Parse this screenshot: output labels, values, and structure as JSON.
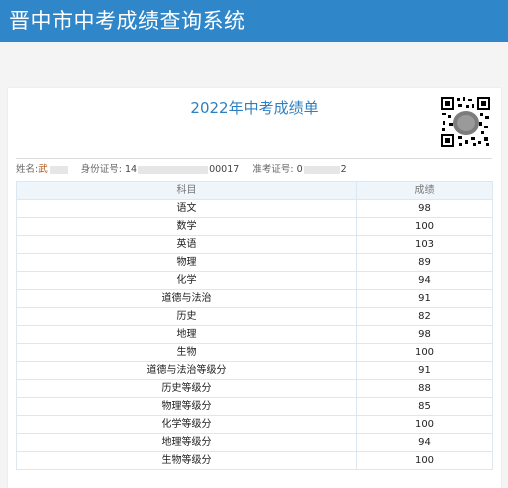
{
  "header": {
    "title": "晋中市中考成绩查询系统",
    "color": "#2f86c8"
  },
  "document": {
    "title": "2022年中考成绩单"
  },
  "student": {
    "name_label": "姓名:",
    "name_value": "武",
    "id_label": "身份证号:",
    "id_prefix": "14",
    "id_suffix": "00017",
    "exam_label": "准考证号:",
    "exam_prefix": "0",
    "exam_suffix": "2"
  },
  "table": {
    "headers": [
      "科目",
      "成绩"
    ],
    "rows": [
      [
        "语文",
        "98"
      ],
      [
        "数学",
        "100"
      ],
      [
        "英语",
        "103"
      ],
      [
        "物理",
        "89"
      ],
      [
        "化学",
        "94"
      ],
      [
        "道德与法治",
        "91"
      ],
      [
        "历史",
        "82"
      ],
      [
        "地理",
        "98"
      ],
      [
        "生物",
        "100"
      ],
      [
        "道德与法治等级分",
        "91"
      ],
      [
        "历史等级分",
        "88"
      ],
      [
        "物理等级分",
        "85"
      ],
      [
        "化学等级分",
        "100"
      ],
      [
        "地理等级分",
        "94"
      ],
      [
        "生物等级分",
        "100"
      ]
    ]
  }
}
